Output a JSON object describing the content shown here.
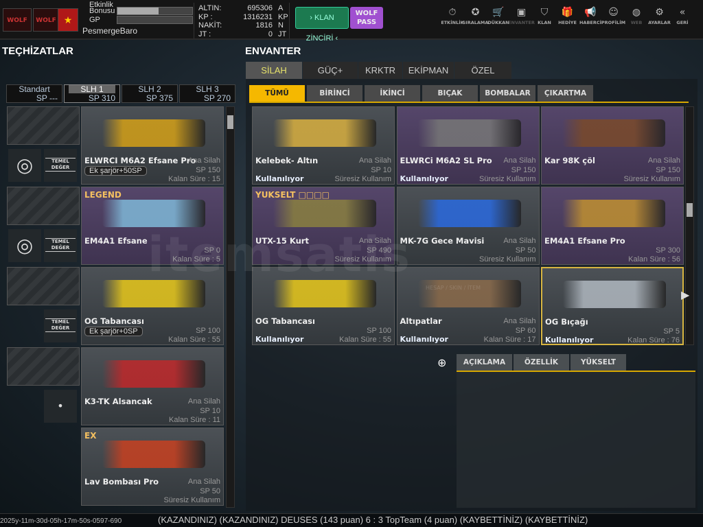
{
  "header": {
    "logo_text": "WOLF",
    "event_bonus_label": "Etkinlik Bonusu",
    "event_bonus_progress": 0.55,
    "gp_label": "GP",
    "gp_progress": 0,
    "username": "PesmergeBaro",
    "currencies": [
      {
        "label": "ALTIN:",
        "value": "695306",
        "unit": "A"
      },
      {
        "label": "KP :",
        "value": "1316231",
        "unit": "KP"
      },
      {
        "label": "NAKİT:",
        "value": "1816",
        "unit": "N"
      },
      {
        "label": "JT :",
        "value": "0",
        "unit": "JT"
      }
    ],
    "klan_button": "› KLAN ZİNCİRİ ‹",
    "wolf_pass": "WOLF PASS",
    "nav": [
      {
        "label": "ETKİNLİK",
        "icon": "⏱"
      },
      {
        "label": "SIRALAMA",
        "icon": "✪"
      },
      {
        "label": "DÜKKAN",
        "icon": "🛒"
      },
      {
        "label": "ENVANTER",
        "icon": "▣"
      },
      {
        "label": "KLAN",
        "icon": "⛉"
      },
      {
        "label": "HEDİYE",
        "icon": "🎁"
      },
      {
        "label": "HABERCİ",
        "icon": "📢"
      },
      {
        "label": "PROFİLİM",
        "icon": "☺"
      },
      {
        "label": "WEB",
        "icon": "◍"
      },
      {
        "label": "AYARLAR",
        "icon": "⚙"
      },
      {
        "label": "GERİ",
        "icon": "«"
      }
    ]
  },
  "left": {
    "title": "TEÇHİZATLAR",
    "loadouts": [
      {
        "name": "Standart",
        "sp": "SP ---"
      },
      {
        "name": "SLH 1",
        "sp": "SP 310",
        "active": true
      },
      {
        "name": "SLH 2",
        "sp": "SP 375"
      },
      {
        "name": "SLH 3",
        "sp": "SP 270"
      }
    ],
    "temel_line1": "TEMEL",
    "temel_line2": "DEĞER",
    "items": [
      {
        "name": "ELWRCI M6A2 Efsane Pro",
        "type": "Ana Silah",
        "sp": "SP 150",
        "remaining": "Kalan Süre : 15",
        "extra": "Ek şarjör+50SP",
        "color": "#d4a017"
      },
      {
        "name": "EM4A1 Efsane",
        "sp": "SP 0",
        "remaining": "Kalan Süre : 5",
        "badge": "LEGEND",
        "purple": true,
        "color": "#7fb8d8"
      },
      {
        "name": "OG Tabancası",
        "sp": "SP 100",
        "remaining": "Kalan Süre : 55",
        "extra": "Ek şarjör+0SP",
        "color": "#e8c81a"
      },
      {
        "name": "K3-TK Alsancak",
        "type": "Ana Silah",
        "sp": "SP 10",
        "remaining": "Kalan Süre : 11",
        "color": "#c0282a"
      },
      {
        "name": "Lav Bombası Pro",
        "type": "Ana Silah",
        "sp": "SP 50",
        "remaining": "Süresiz Kullanım",
        "badge": "EX",
        "color": "#c84020"
      }
    ]
  },
  "inventory": {
    "title": "ENVANTER",
    "tabs": [
      "SİLAH",
      "GÜÇ+",
      "KRKTR",
      "EKİPMAN",
      "ÖZEL"
    ],
    "subtabs": [
      "TÜMÜ",
      "BİRİNCİ",
      "İKİNCİ",
      "BIÇAK",
      "BOMBALAR",
      "ÇIKARTMA"
    ],
    "items": [
      {
        "name": "Kelebek- Altın",
        "type": "Ana Silah",
        "sp": "SP 10",
        "remaining": "Süresiz Kullanım",
        "status": "Kullanılıyor",
        "color": "#d9b040"
      },
      {
        "name": "ELWRCi M6A2 SL Pro",
        "type": "Ana Silah",
        "sp": "SP 150",
        "remaining": "Süresiz Kullanım",
        "status": "Kullanılıyor",
        "purple": true,
        "color": "#777"
      },
      {
        "name": "Kar 98K çöl",
        "type": "Ana Silah",
        "sp": "SP 150",
        "remaining": "Süresiz Kullanım",
        "purple": true,
        "color": "#7a4a2a"
      },
      {
        "name": "UTX-15 Kurt",
        "type": "Ana Silah",
        "sp": "SP 490",
        "remaining": "Süresiz Kullanım",
        "badge": "YUKSELT □□□□",
        "purple": true,
        "color": "#8a8040"
      },
      {
        "name": "MK-7G Gece Mavisi",
        "type": "Ana Silah",
        "sp": "SP 50",
        "remaining": "Süresiz Kullanım",
        "color": "#2a6ae0"
      },
      {
        "name": "EM4A1 Efsane Pro",
        "sp": "SP 300",
        "remaining": "Kalan Süre : 56",
        "purple": true,
        "color": "#c09030"
      },
      {
        "name": "OG Tabancası",
        "sp": "SP 100",
        "remaining": "Kalan Süre : 55",
        "status": "Kullanılıyor",
        "color": "#e8c81a"
      },
      {
        "name": "Altıpatlar",
        "type": "Ana Silah",
        "sp": "SP 60",
        "remaining": "Kalan Süre : 17",
        "status": "Kullanılıyor",
        "color": "#8a6a4a"
      },
      {
        "name": "OG Bıçağı",
        "sp": "SP 5",
        "remaining": "Kalan Süre : 76",
        "status": "Kullanılıyor",
        "selected": true,
        "color": "#b0b8c0"
      }
    ]
  },
  "detail": {
    "tabs": [
      "AÇIKLAMA",
      "ÖZELLİK",
      "YÜKSELT"
    ]
  },
  "watermark": {
    "brand": "itemsatis",
    "tagline": "HESAP / SKIN / İTEM"
  },
  "ticker": {
    "text": "(KAZANDINIZ)        (KAZANDINIZ) DEUSES (143 puan) 6 : 3 TopTeam (4 puan) (KAYBETTİNİZ)          (KAYBETTİNİZ)",
    "timestamp": "2025y-11m-30d-05h-17m-50s-0597-690"
  }
}
